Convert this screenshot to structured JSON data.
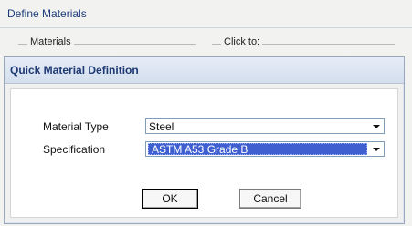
{
  "background_window": {
    "title": "Define Materials",
    "group_materials_label": "Materials",
    "group_click_to_label": "Click to:"
  },
  "dialog": {
    "title": "Quick Material Definition",
    "material_type": {
      "label": "Material Type",
      "value": "Steel"
    },
    "specification": {
      "label": "Specification",
      "value": "ASTM A53 Grade B"
    },
    "ok_label": "OK",
    "cancel_label": "Cancel"
  },
  "colors": {
    "title_text": "#1e3a73",
    "selection_highlight": "#3f5fd0"
  }
}
